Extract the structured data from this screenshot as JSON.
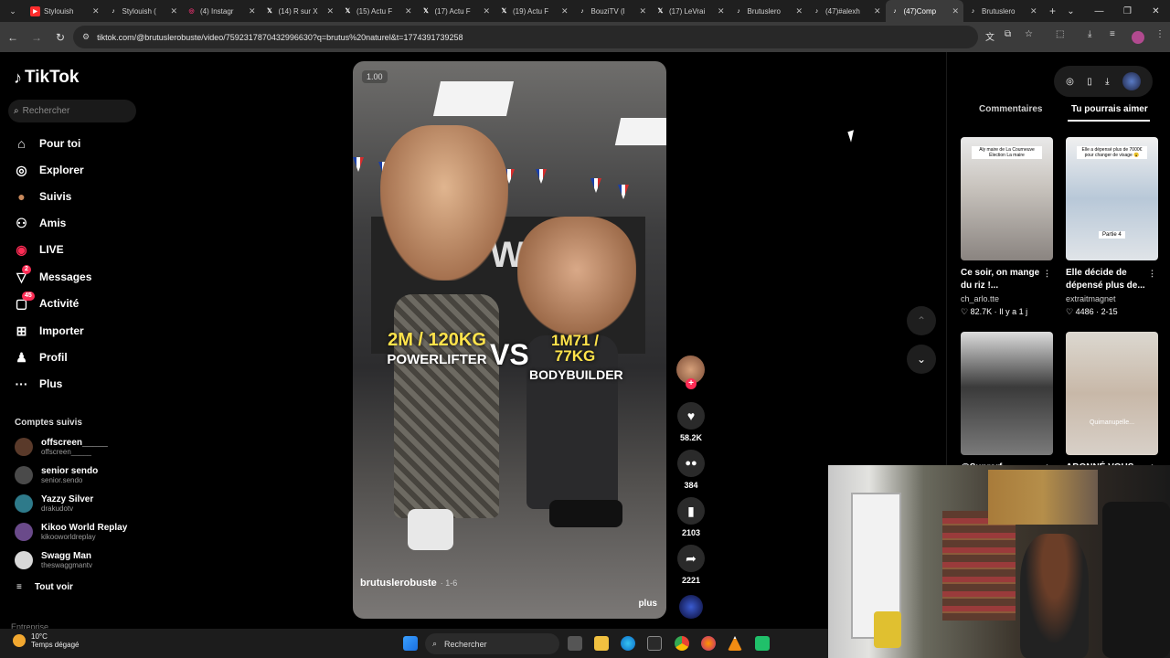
{
  "tabs": [
    {
      "title": "Stylouish",
      "icon": "youtube-icon",
      "color": "#ff2d2d"
    },
    {
      "title": "Stylouish (",
      "icon": "tiktok-icon",
      "color": "#ffffff"
    },
    {
      "title": "(4) Instagr",
      "icon": "instagram-icon",
      "color": "#e1306c"
    },
    {
      "title": "(14) R sur X",
      "icon": "x-icon",
      "color": "#ffffff"
    },
    {
      "title": "(15) Actu F",
      "icon": "x-icon",
      "color": "#ffffff"
    },
    {
      "title": "(17) Actu F",
      "icon": "x-icon",
      "color": "#ffffff"
    },
    {
      "title": "(19) Actu F",
      "icon": "x-icon",
      "color": "#ffffff"
    },
    {
      "title": "BouziTV (l",
      "icon": "tiktok-icon",
      "color": "#ffffff"
    },
    {
      "title": "(17) LeVrai",
      "icon": "x-icon",
      "color": "#ffffff"
    },
    {
      "title": "Brutuslero",
      "icon": "tiktok-icon",
      "color": "#ffffff"
    },
    {
      "title": "(47)#alexh",
      "icon": "tiktok-icon",
      "color": "#ffffff"
    },
    {
      "title": "(47)Comp",
      "icon": "tiktok-icon",
      "color": "#ffffff",
      "active": true
    },
    {
      "title": "Brutuslero",
      "icon": "tiktok-icon",
      "color": "#ffffff"
    }
  ],
  "address": {
    "url": "tiktok.com/@brutuslerobuste/video/7592317870432996630?q=brutus%20naturel&t=1774391739258"
  },
  "sidebar": {
    "logo": "TikTok",
    "search_placeholder": "Rechercher",
    "nav": [
      {
        "label": "Pour toi",
        "icon": "home-icon"
      },
      {
        "label": "Explorer",
        "icon": "compass-icon"
      },
      {
        "label": "Suivis",
        "icon": "following-avatar-icon"
      },
      {
        "label": "Amis",
        "icon": "friends-icon"
      },
      {
        "label": "LIVE",
        "icon": "live-icon"
      },
      {
        "label": "Messages",
        "icon": "messages-icon",
        "badge": "2"
      },
      {
        "label": "Activité",
        "icon": "activity-icon",
        "badge": "45"
      },
      {
        "label": "Importer",
        "icon": "upload-icon"
      },
      {
        "label": "Profil",
        "icon": "profile-icon"
      },
      {
        "label": "Plus",
        "icon": "more-icon"
      }
    ],
    "following_title": "Comptes suivis",
    "following": [
      {
        "name": "offscreen_____",
        "handle": "offscreen_____"
      },
      {
        "name": "senior sendo",
        "handle": "senior.sendo"
      },
      {
        "name": "Yazzy Silver",
        "handle": "drakudotv"
      },
      {
        "name": "Kikoo World Replay",
        "handle": "kikooworldreplay"
      },
      {
        "name": "Swagg Man",
        "handle": "theswaggmantv"
      }
    ],
    "see_all": "Tout voir",
    "footer": "Entreprise"
  },
  "video": {
    "speed": "1.00",
    "left_main": "2M / 120KG",
    "left_sub": "POWERLIFTER",
    "vs": "VS",
    "right_main": "1M71 / 77KG",
    "right_sub": "BODYBUILDER",
    "author": "brutuslerobuste",
    "author_date": "· 1-6",
    "more": "plus"
  },
  "actions": {
    "likes": "58.2K",
    "comments": "384",
    "saves": "2103",
    "shares": "2221"
  },
  "right_panel": {
    "tab_comments": "Commentaires",
    "tab_suggest": "Tu pourrais aimer",
    "cards": [
      {
        "title": "Ce soir, on mange du riz !...",
        "author": "ch_arlo.tte",
        "meta": "♡ 82.7K · Il y a 1 j",
        "caption": "Aly maire de La Courneuve Élection La maire"
      },
      {
        "title": "Elle décide de dépensé plus de...",
        "author": "extraitmagnet",
        "meta": "♡ 4486 · 2-15",
        "caption": "Elle a dépensé plus de 7000€ pour changer de visage 😮"
      },
      {
        "title": "@Suprarf...",
        "author": "",
        "meta": "",
        "caption": ""
      },
      {
        "title": "ABONNÉ VOUS...",
        "author": "",
        "meta": "",
        "caption": "Quimanupelle..."
      }
    ]
  },
  "taskbar": {
    "temp": "10°C",
    "weather": "Temps dégagé",
    "search": "Rechercher"
  }
}
